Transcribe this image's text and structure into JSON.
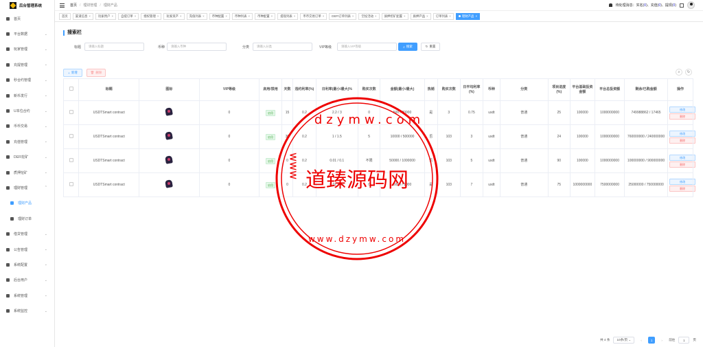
{
  "app": {
    "title": "后台管理系统"
  },
  "sidebar": {
    "items": [
      {
        "label": "首页",
        "arrow": ""
      },
      {
        "label": "平台数据",
        "arrow": "⌄"
      },
      {
        "label": "玩家管理",
        "arrow": "⌄"
      },
      {
        "label": "充提管理",
        "arrow": "⌄"
      },
      {
        "label": "秒合约管理",
        "arrow": "⌄"
      },
      {
        "label": "新币发行",
        "arrow": "⌄"
      },
      {
        "label": "U本位合约",
        "arrow": "⌄"
      },
      {
        "label": "币币交易",
        "arrow": "⌄"
      },
      {
        "label": "充值管理",
        "arrow": "⌄"
      },
      {
        "label": "DEFI挖矿",
        "arrow": "⌄"
      },
      {
        "label": "质押挖矿",
        "arrow": "⌄"
      },
      {
        "label": "理财管理",
        "arrow": "⌃"
      },
      {
        "label": "理财产品",
        "arrow": ""
      },
      {
        "label": "理财订单",
        "arrow": ""
      },
      {
        "label": "借贷管理",
        "arrow": "⌄"
      },
      {
        "label": "公告管理",
        "arrow": "⌄"
      },
      {
        "label": "系统配置",
        "arrow": "⌄"
      },
      {
        "label": "后台用户",
        "arrow": "⌄"
      },
      {
        "label": "系统管理",
        "arrow": "⌄"
      },
      {
        "label": "系统监控",
        "arrow": "⌄"
      }
    ]
  },
  "header": {
    "breadcrumb": [
      "首页",
      "理财管理",
      "理财产品"
    ],
    "pending": "待处理消息：实名(",
    "v1": "0",
    "mid1": ")、充值(",
    "v2": "0",
    "mid2": ")、提现(",
    "v3": "0",
    "end": ")"
  },
  "tags": [
    "首页",
    "渠道信息",
    "玩家用户",
    "自提订单",
    "授权管理",
    "玩家资产",
    "充值列表",
    "币种配置",
    "币种列表",
    "币种配置",
    "提现列表",
    "币币交易订单",
    "DEFI订单列表",
    "空投活动",
    "质押挖矿配置",
    "质押产品",
    "订单列表",
    "理财产品"
  ],
  "search": {
    "title": "搜索栏",
    "title_label": "标题",
    "title_ph": "请输入标题",
    "coin_label": "币种",
    "coin_ph": "请输入币种",
    "cat_label": "分类",
    "cat_ph": "请输入分类",
    "vip_label": "VIP等级",
    "vip_ph": "请输入VIP等级",
    "search_btn": "搜索",
    "reset_btn": "重置"
  },
  "toolbar": {
    "add": "新增",
    "delete": "删除"
  },
  "table": {
    "headers": [
      "标题",
      "图标",
      "VIP等级",
      "启用/禁用",
      "天数",
      "违约利率(%)",
      "日利率(最小/最大)%",
      "购买次数",
      "金额(最小/最大)",
      "热销",
      "购买次数",
      "日平均利率(%)",
      "币种",
      "分类",
      "项目进度(%)",
      "平台基础投资金额",
      "平台总投资额",
      "剩余/已购金额",
      "操作"
    ],
    "rows": [
      [
        "USDTSmart contract",
        "0",
        "启用",
        "15",
        "0.2",
        "2.2 / 3",
        "0",
        "500 / 20000",
        "是",
        "3",
        "0.75",
        "usdt",
        "普通",
        "25",
        "100000",
        "1000000000",
        "749988862 / 17465",
        "修改",
        "删除"
      ],
      [
        "USDTSmart contract",
        "0",
        "启用",
        "30",
        "0.2",
        "1 / 1.5",
        "5",
        "10000 / 500000",
        "否",
        "103",
        "3",
        "usdt",
        "普通",
        "24",
        "100000",
        "1000000000",
        "760000000 / 240000000",
        "修改",
        "删除"
      ],
      [
        "USDTSmart contract",
        "0",
        "启用",
        "0",
        "0.2",
        "0.01 / 0.1",
        "不限",
        "50000 / 1000000",
        "否",
        "103",
        "5",
        "usdt",
        "普通",
        "90",
        "100000",
        "1000000000",
        "100000000 / 900000000",
        "修改",
        "删除"
      ],
      [
        "USDTSmart contract",
        "0",
        "启用",
        "0",
        "0.2",
        "0.01 / 0.1",
        "0",
        "5000 / 1000",
        "是",
        "103",
        "7",
        "usdt",
        "普通",
        "75",
        "1000000000",
        "7500000000",
        "25000000 / 750000000",
        "修改",
        "删除"
      ]
    ]
  },
  "pager": {
    "total": "共 4 条",
    "size": "10条/页",
    "page": "1",
    "goto": "前往",
    "goto_val": "1",
    "unit": "页"
  },
  "watermark": {
    "text": "道臻源码网",
    "url_top": "dzymw.com",
    "www": "www",
    "url_bottom": "www.dzymw.com"
  }
}
